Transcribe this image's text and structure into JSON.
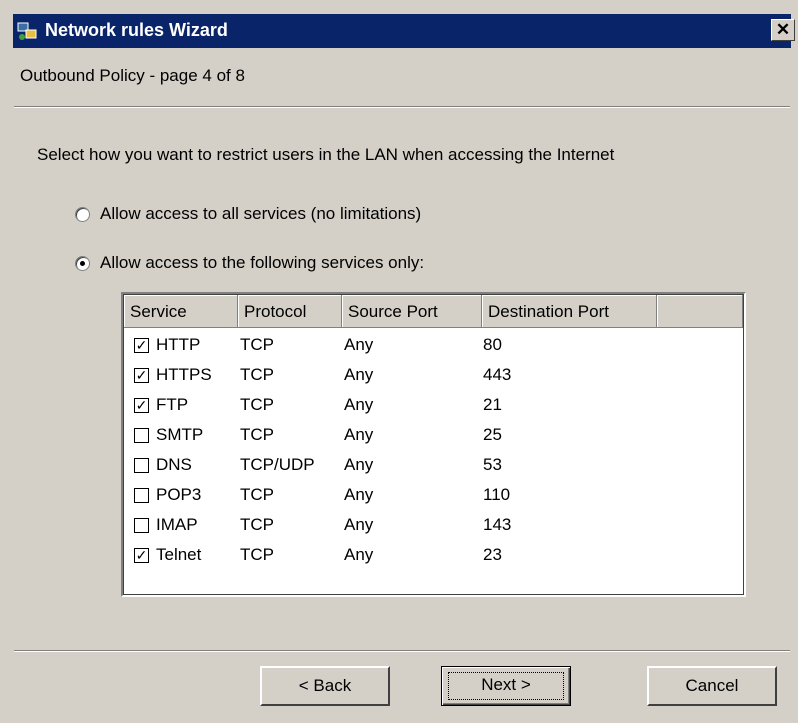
{
  "window": {
    "title": "Network rules Wizard",
    "close_glyph": "✕",
    "app_icon": "network-wizard-icon",
    "title_bar_color": "#0a246a"
  },
  "subtitle": "Outbound Policy - page 4 of 8",
  "instruction": "Select how you want to restrict users in the LAN when accessing the Internet",
  "options": [
    {
      "label": "Allow access to all services (no limitations)",
      "selected": false
    },
    {
      "label": "Allow access to the following services only:",
      "selected": true
    }
  ],
  "table": {
    "columns": [
      "Service",
      "Protocol",
      "Source Port",
      "Destination Port"
    ],
    "rows": [
      {
        "checked": true,
        "service": "HTTP",
        "protocol": "TCP",
        "source": "Any",
        "dest": "80"
      },
      {
        "checked": true,
        "service": "HTTPS",
        "protocol": "TCP",
        "source": "Any",
        "dest": "443"
      },
      {
        "checked": true,
        "service": "FTP",
        "protocol": "TCP",
        "source": "Any",
        "dest": "21"
      },
      {
        "checked": false,
        "service": "SMTP",
        "protocol": "TCP",
        "source": "Any",
        "dest": "25"
      },
      {
        "checked": false,
        "service": "DNS",
        "protocol": "TCP/UDP",
        "source": "Any",
        "dest": "53"
      },
      {
        "checked": false,
        "service": "POP3",
        "protocol": "TCP",
        "source": "Any",
        "dest": "110"
      },
      {
        "checked": false,
        "service": "IMAP",
        "protocol": "TCP",
        "source": "Any",
        "dest": "143"
      },
      {
        "checked": true,
        "service": "Telnet",
        "protocol": "TCP",
        "source": "Any",
        "dest": "23"
      }
    ]
  },
  "buttons": {
    "back": {
      "label": "< Back"
    },
    "next": {
      "label": "Next >"
    },
    "cancel": {
      "label": "Cancel"
    }
  }
}
